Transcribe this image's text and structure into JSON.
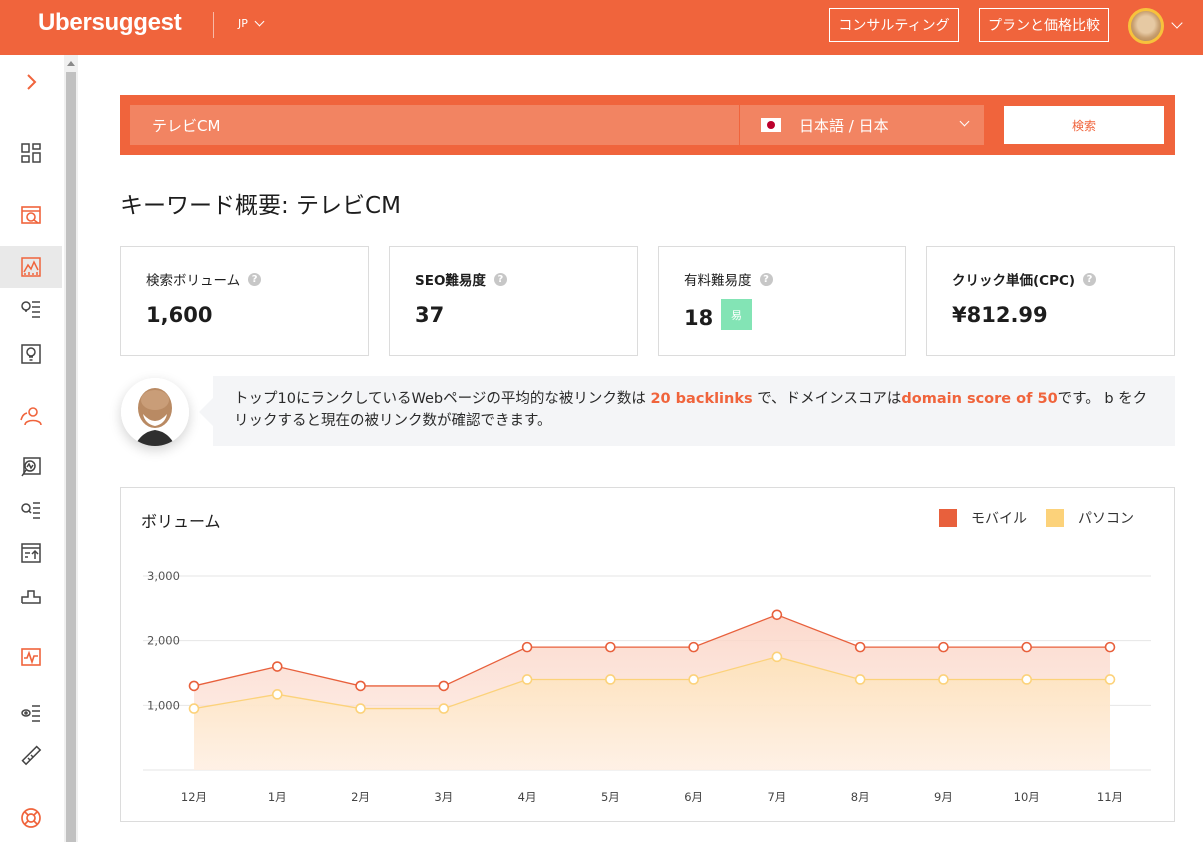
{
  "app": {
    "logo": "Ubersuggest",
    "country": "JP",
    "consult_label": "コンサルティング",
    "plans_label": "プランと価格比較"
  },
  "search": {
    "query": "テレビCM",
    "locale": "日本語 / 日本",
    "button": "検索"
  },
  "page_title": "キーワード概要: テレビCM",
  "metrics": [
    {
      "label": "検索ボリューム",
      "value": "1,600"
    },
    {
      "label": "SEO難易度",
      "value": "37"
    },
    {
      "label": "有料難易度",
      "value": "18",
      "badge": "易"
    },
    {
      "label": "クリック単価(CPC)",
      "value": "¥812.99"
    }
  ],
  "tip": {
    "text_1": "トップ10にランクしているWebページの平均的な被リンク数は ",
    "hl_1": "20 backlinks",
    "text_2": " で、ドメインスコアは",
    "hl_2": "domain score of 50",
    "text_3": "です。 b をクリックすると現在の被リンク数が確認できます。"
  },
  "chart_data": {
    "type": "area",
    "title": "ボリューム",
    "categories": [
      "12月",
      "1月",
      "2月",
      "3月",
      "4月",
      "5月",
      "6月",
      "7月",
      "8月",
      "9月",
      "10月",
      "11月"
    ],
    "ylim": [
      0,
      3000
    ],
    "yticks": [
      "1,000",
      "2,000",
      "3,000"
    ],
    "ytick_values": [
      1000,
      2000,
      3000
    ],
    "grid": true,
    "legend_position": "top-right",
    "series": [
      {
        "name": "モバイル",
        "color": "#e8603c",
        "values": [
          1300,
          1600,
          1300,
          1300,
          1900,
          1900,
          1900,
          2400,
          1900,
          1900,
          1900,
          1900
        ]
      },
      {
        "name": "パソコン",
        "color": "#fcd27a",
        "values": [
          950,
          1170,
          950,
          950,
          1400,
          1400,
          1400,
          1750,
          1400,
          1400,
          1400,
          1400
        ]
      }
    ]
  },
  "colors": {
    "brand": "#f0643c",
    "easy_badge": "#83e4b5"
  },
  "sidebar_icons": [
    "expand-chevron-icon",
    "dashboard-icon",
    "project-icon",
    "keyword-overview-icon",
    "keyword-ideas-icon",
    "content-ideas-icon",
    "competitor-icon",
    "traffic-analyzer-icon",
    "keyword-research-icon",
    "top-pages-icon",
    "backlinks-icon",
    "rank-tracking-icon",
    "site-audit-icon",
    "chrome-extension-icon",
    "support-icon"
  ]
}
